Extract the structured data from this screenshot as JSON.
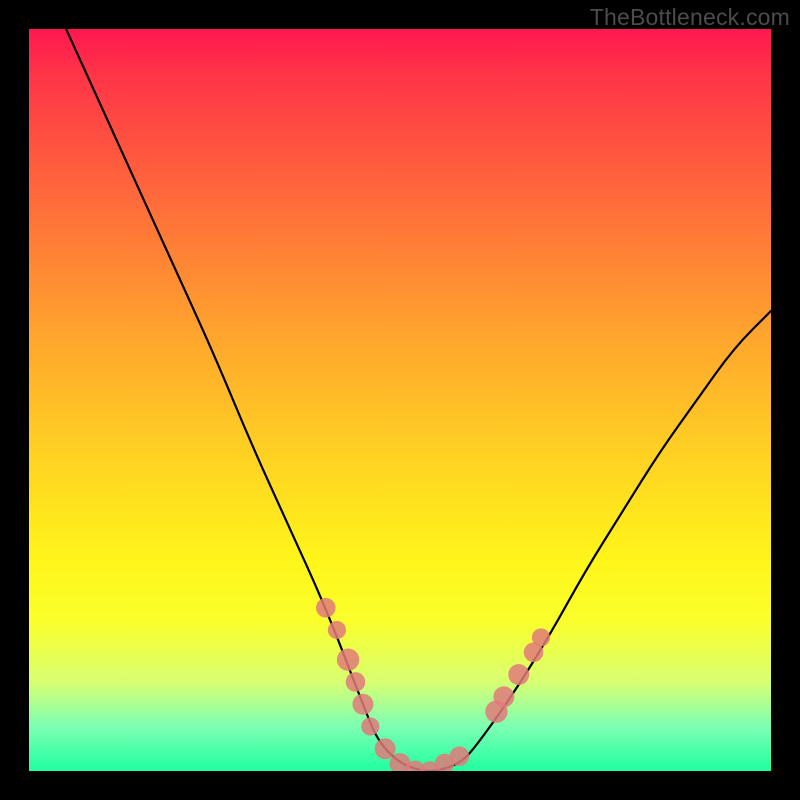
{
  "watermark": "TheBottleneck.com",
  "chart_data": {
    "type": "line",
    "title": "",
    "xlabel": "",
    "ylabel": "",
    "xlim": [
      0,
      100
    ],
    "ylim": [
      0,
      100
    ],
    "series": [
      {
        "name": "bottleneck-curve",
        "x": [
          5,
          10,
          15,
          20,
          25,
          30,
          35,
          40,
          45,
          47,
          50,
          53,
          55,
          58,
          60,
          65,
          70,
          75,
          80,
          85,
          90,
          95,
          100
        ],
        "y": [
          100,
          89,
          78,
          67,
          56,
          44,
          33,
          22,
          9,
          4,
          1,
          0,
          0,
          1,
          3,
          10,
          18,
          27,
          35,
          43,
          50,
          57,
          62
        ]
      }
    ],
    "markers": {
      "name": "highlighted-points",
      "color": "#e07a7a",
      "points": [
        {
          "x": 40,
          "y": 22,
          "r": 1.4
        },
        {
          "x": 41.5,
          "y": 19,
          "r": 1.3
        },
        {
          "x": 43,
          "y": 15,
          "r": 1.6
        },
        {
          "x": 44,
          "y": 12,
          "r": 1.4
        },
        {
          "x": 45,
          "y": 9,
          "r": 1.5
        },
        {
          "x": 46,
          "y": 6,
          "r": 1.3
        },
        {
          "x": 48,
          "y": 3,
          "r": 1.5
        },
        {
          "x": 50,
          "y": 1,
          "r": 1.5
        },
        {
          "x": 52,
          "y": 0,
          "r": 1.5
        },
        {
          "x": 54,
          "y": 0,
          "r": 1.4
        },
        {
          "x": 56,
          "y": 1,
          "r": 1.4
        },
        {
          "x": 58,
          "y": 2,
          "r": 1.4
        },
        {
          "x": 63,
          "y": 8,
          "r": 1.6
        },
        {
          "x": 64,
          "y": 10,
          "r": 1.5
        },
        {
          "x": 66,
          "y": 13,
          "r": 1.5
        },
        {
          "x": 68,
          "y": 16,
          "r": 1.4
        },
        {
          "x": 69,
          "y": 18,
          "r": 1.3
        }
      ]
    }
  }
}
